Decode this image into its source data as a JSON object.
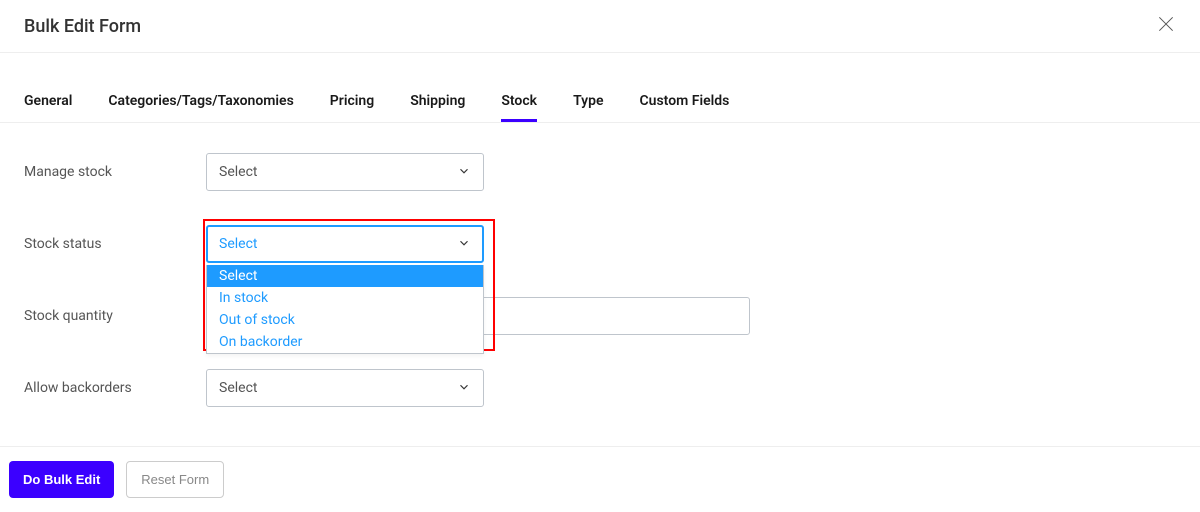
{
  "header": {
    "title": "Bulk Edit Form"
  },
  "tabs": {
    "items": [
      {
        "label": "General"
      },
      {
        "label": "Categories/Tags/Taxonomies"
      },
      {
        "label": "Pricing"
      },
      {
        "label": "Shipping"
      },
      {
        "label": "Stock"
      },
      {
        "label": "Type"
      },
      {
        "label": "Custom Fields"
      }
    ],
    "active_index": 4
  },
  "form": {
    "manage_stock": {
      "label": "Manage stock",
      "value": "Select"
    },
    "stock_status": {
      "label": "Stock status",
      "value": "Select",
      "options": [
        "Select",
        "In stock",
        "Out of stock",
        "On backorder"
      ],
      "selected_index": 0,
      "open": true
    },
    "stock_quantity": {
      "label": "Stock quantity",
      "value": ""
    },
    "allow_backorders": {
      "label": "Allow backorders",
      "value": "Select"
    }
  },
  "footer": {
    "submit_label": "Do Bulk Edit",
    "reset_label": "Reset Form"
  }
}
